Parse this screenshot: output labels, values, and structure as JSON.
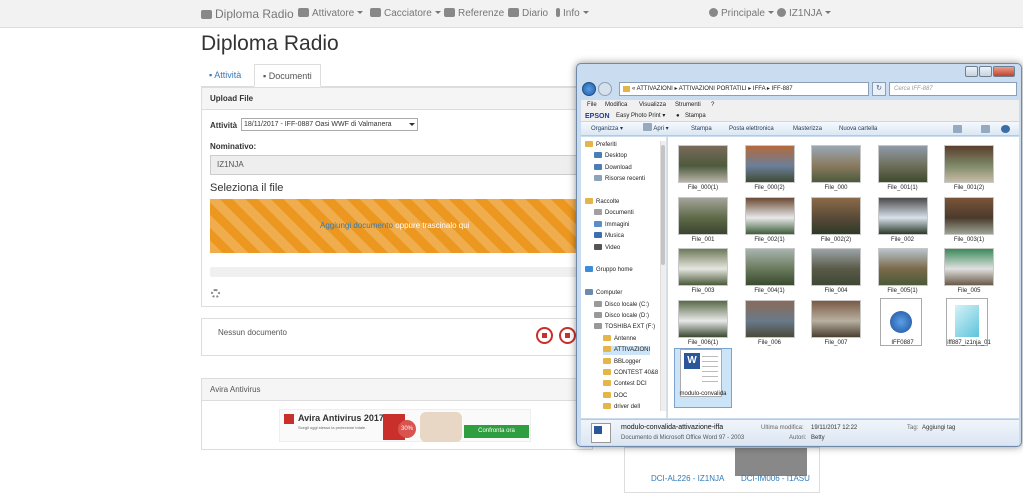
{
  "navbar": {
    "brand": "Diploma Radio",
    "items": [
      {
        "label": "Attivatore",
        "icon": "car-icon"
      },
      {
        "label": "Cacciatore",
        "icon": "monitor-icon"
      },
      {
        "label": "Referenze",
        "icon": "map-icon"
      },
      {
        "label": "Diario",
        "icon": "book-icon"
      },
      {
        "label": "Info",
        "icon": "info-icon"
      }
    ],
    "right": [
      {
        "label": "Principale",
        "icon": "globe-icon"
      },
      {
        "label": "IZ1NJA",
        "icon": "user-icon"
      }
    ]
  },
  "page": {
    "title": "Diploma Radio",
    "tabs": [
      "Attività",
      "Documenti"
    ]
  },
  "upload": {
    "header": "Upload File",
    "attivita_label": "Attività",
    "attivita_value": "18/11/2017 - IFF-0887 Oasi WWF di Valmanera",
    "nominativo_label": "Nominativo:",
    "nominativo_value": "IZ1NJA",
    "select_file_title": "Seleziona il file",
    "dropzone_link": "Aggiungi documento",
    "dropzone_text": "oppure trascinalo qui"
  },
  "documents": {
    "empty_text": "Nessun documento"
  },
  "antivirus": {
    "header": "Avira Antivirus",
    "ad_title": "Avira Antivirus 2017",
    "ad_subtitle": "Scegli oggi stesso la protezione totale.",
    "ad_badge": "30%",
    "ad_button": "Confronta ora"
  },
  "background_cards": [
    "DCI-AL226 - IZ1NJA",
    "DCI-IM006 - I1ASU"
  ],
  "explorer": {
    "address": "«  ATTIVAZIONI  ▸  ATTIVAZIONI PORTATILI  ▸  IFFA  ▸  IFF-887",
    "search_placeholder": "Cerca IFF-887",
    "menu": [
      "File",
      "Modifica",
      "Visualizza",
      "Strumenti",
      "?"
    ],
    "epson": {
      "brand": "EPSON",
      "items": [
        "Easy Photo Print ▾",
        "Stampa"
      ]
    },
    "toolbar": [
      "Organizza ▾",
      "Apri ▾",
      "Stampa",
      "Posta elettronica",
      "Masterizza",
      "Nuova cartella"
    ],
    "nav": [
      {
        "label": "Preferiti",
        "color": "#e5b54a",
        "indent": 0
      },
      {
        "label": "Desktop",
        "color": "#4a7fb5",
        "indent": 1
      },
      {
        "label": "Download",
        "color": "#4a7fb5",
        "indent": 1
      },
      {
        "label": "Risorse recenti",
        "color": "#8fa3b8",
        "indent": 1
      },
      {
        "label": "",
        "color": "",
        "indent": 0
      },
      {
        "label": "Raccolte",
        "color": "#e5b54a",
        "indent": 0
      },
      {
        "label": "Documenti",
        "color": "#a0a0a0",
        "indent": 1
      },
      {
        "label": "Immagini",
        "color": "#5a8ec4",
        "indent": 1
      },
      {
        "label": "Musica",
        "color": "#3c6fb0",
        "indent": 1
      },
      {
        "label": "Video",
        "color": "#555",
        "indent": 1
      },
      {
        "label": "",
        "color": "",
        "indent": 0
      },
      {
        "label": "Gruppo home",
        "color": "#3a8fd8",
        "indent": 0
      },
      {
        "label": "",
        "color": "",
        "indent": 0
      },
      {
        "label": "Computer",
        "color": "#6a8bb0",
        "indent": 0
      },
      {
        "label": "Disco locale (C:)",
        "color": "#999",
        "indent": 1
      },
      {
        "label": "Disco locale (D:)",
        "color": "#999",
        "indent": 1
      },
      {
        "label": "TOSHIBA EXT (F:)",
        "color": "#999",
        "indent": 1
      },
      {
        "label": "Antenne",
        "color": "#e5b54a",
        "indent": 2
      },
      {
        "label": "ATTIVAZIONI",
        "color": "#e5b54a",
        "indent": 2
      },
      {
        "label": "BBLogger",
        "color": "#e5b54a",
        "indent": 2
      },
      {
        "label": "CONTEST 40&8",
        "color": "#e5b54a",
        "indent": 2
      },
      {
        "label": "Contest DCI",
        "color": "#e5b54a",
        "indent": 2
      },
      {
        "label": "DOC",
        "color": "#e5b54a",
        "indent": 2
      },
      {
        "label": "driver dell",
        "color": "#e5b54a",
        "indent": 2
      }
    ],
    "files": [
      {
        "name": "File_000(1)",
        "kind": "photo",
        "colors": [
          "#7a6a5a",
          "#4d5a3e",
          "#b9b3a8"
        ]
      },
      {
        "name": "File_000(2)",
        "kind": "photo",
        "colors": [
          "#b46a3c",
          "#6b7f9a",
          "#3f4a34"
        ]
      },
      {
        "name": "File_000",
        "kind": "photo",
        "colors": [
          "#9aa7b4",
          "#8a7a5e",
          "#4b5b3c"
        ]
      },
      {
        "name": "File_001(1)",
        "kind": "photo",
        "colors": [
          "#8e9aa8",
          "#6e6e5a",
          "#3e4a2c"
        ]
      },
      {
        "name": "File_001(2)",
        "kind": "photo",
        "colors": [
          "#5a3e2c",
          "#7e8a6a",
          "#c8bca6"
        ]
      },
      {
        "name": "File_001",
        "kind": "photo",
        "colors": [
          "#a4a49a",
          "#5e6a48",
          "#3a4430"
        ]
      },
      {
        "name": "File_002(1)",
        "kind": "photo",
        "colors": [
          "#6a4a34",
          "#e8e8e8",
          "#3e5e3a"
        ]
      },
      {
        "name": "File_002(2)",
        "kind": "photo",
        "colors": [
          "#8a6a48",
          "#5a4a38",
          "#2e3a28"
        ]
      },
      {
        "name": "File_002",
        "kind": "photo",
        "colors": [
          "#4a4a4a",
          "#d8e0ea",
          "#2a3a2a"
        ]
      },
      {
        "name": "File_003(1)",
        "kind": "photo",
        "colors": [
          "#7a5438",
          "#4a3a2c",
          "#9aa494"
        ]
      },
      {
        "name": "File_003",
        "kind": "photo",
        "colors": [
          "#6e7a5a",
          "#e6e6e0",
          "#4a5a3a"
        ]
      },
      {
        "name": "File_004(1)",
        "kind": "photo",
        "colors": [
          "#a8b4b0",
          "#6a7a5c",
          "#3a4a2e"
        ]
      },
      {
        "name": "File_004",
        "kind": "photo",
        "colors": [
          "#9ca4a8",
          "#5a5a48",
          "#3e4834"
        ]
      },
      {
        "name": "File_005(1)",
        "kind": "photo",
        "colors": [
          "#b8c4cc",
          "#7a6a4a",
          "#4a5a38"
        ]
      },
      {
        "name": "File_005",
        "kind": "photo",
        "colors": [
          "#3a8a5a",
          "#e0e0e0",
          "#6a5a48"
        ]
      },
      {
        "name": "File_006(1)",
        "kind": "photo",
        "colors": [
          "#5a6a48",
          "#e8e8e8",
          "#3a4a30"
        ]
      },
      {
        "name": "File_006",
        "kind": "photo",
        "colors": [
          "#8a6a58",
          "#6a7a8a",
          "#4a4a3a"
        ]
      },
      {
        "name": "File_007",
        "kind": "photo",
        "colors": [
          "#7a5a44",
          "#b8b0a0",
          "#4a3e30"
        ]
      },
      {
        "name": "IFF0887",
        "kind": "kmz",
        "colors": []
      },
      {
        "name": "iff887_iz1nja_01",
        "kind": "doc",
        "colors": []
      },
      {
        "name": "modulo-convalida",
        "kind": "word",
        "colors": []
      }
    ],
    "status": {
      "filename": "modulo-convalida-attivazione-iffa",
      "type": "Documento di Microsoft Office Word 97 - 2003",
      "modified_label": "Ultima modifica:",
      "modified_value": "19/11/2017 12:22",
      "authors_label": "Autori:",
      "authors_value": "Betty",
      "tags_label": "Tag:",
      "tags_value": "Aggiungi tag"
    }
  }
}
